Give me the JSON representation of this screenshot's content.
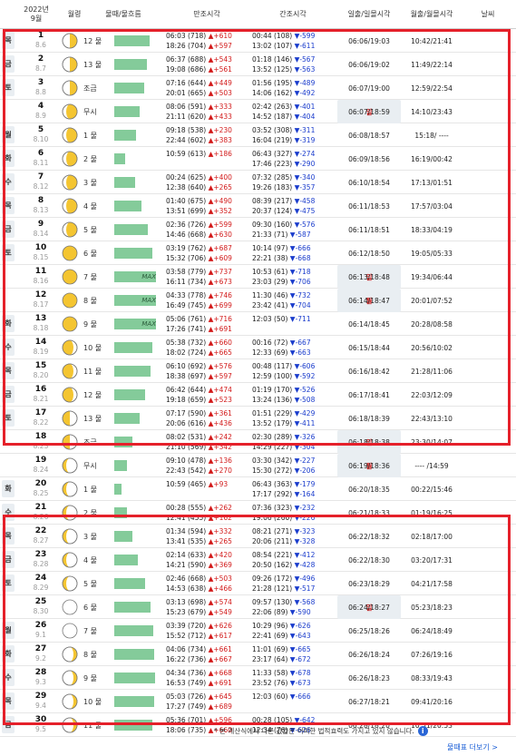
{
  "header": {
    "date": "2022년\n9월",
    "moon_phase": "월령",
    "tide_age": "물때/물흐름",
    "high_tide": "만조시각",
    "low_tide": "간조시각",
    "sunrise_set": "일출/일몰시각",
    "moonrise_set": "월출/월몰시각",
    "weather": "날씨"
  },
  "rows": [
    {
      "dow": "목",
      "sunday": false,
      "day": "1",
      "lunar": "8.6",
      "moon": "first-quarter",
      "tide": "12 물",
      "bar": 0.84,
      "max": "",
      "hw1": "06:03 (718)",
      "hw1d": "▲+610",
      "hw2": "18:26 (704)",
      "hw2d": "▲+597",
      "lw1": "00:44 (108)",
      "lw1d": "▼-599",
      "lw2": "13:02 (107)",
      "lw2d": "▼-611",
      "sun": "06:06/19:03",
      "moonrs": "10:42/21:41"
    },
    {
      "dow": "금",
      "sunday": false,
      "day": "2",
      "lunar": "8.7",
      "moon": "first-quarter",
      "tide": "13 물",
      "bar": 0.79,
      "max": "",
      "hw1": "06:37 (688)",
      "hw1d": "▲+543",
      "hw2": "19:08 (686)",
      "hw2d": "▲+561",
      "lw1": "01:18 (146)",
      "lw1d": "▼-567",
      "lw2": "13:52 (125)",
      "lw2d": "▼-563",
      "sun": "06:06/19:02",
      "moonrs": "11:49/22:14"
    },
    {
      "dow": "토",
      "sunday": false,
      "day": "3",
      "lunar": "8.8",
      "moon": "first-quarter",
      "tide": "조금",
      "bar": 0.71,
      "max": "",
      "hw1": "07:16 (644)",
      "hw1d": "▲+449",
      "hw2": "20:01 (665)",
      "hw2d": "▲+503",
      "lw1": "01:56 (195)",
      "lw1d": "▼-489",
      "lw2": "14:06 (162)",
      "lw2d": "▼-492",
      "sun": "06:07/19:00",
      "moonrs": "12:59/22:54"
    },
    {
      "dow": "일",
      "sunday": true,
      "day": "4",
      "lunar": "8.9",
      "moon": "waxing-gibbous",
      "tide": "무시",
      "bar": 0.6,
      "max": "",
      "hw1": "08:06 (591)",
      "hw1d": "▲+333",
      "hw2": "21:11 (620)",
      "hw2d": "▲+433",
      "lw1": "02:42 (263)",
      "lw1d": "▼-401",
      "lw2": "14:52 (187)",
      "lw2d": "▼-404",
      "sun": "06:07/18:59",
      "moonrs": "14:10/23:43"
    },
    {
      "dow": "월",
      "sunday": false,
      "day": "5",
      "lunar": "8.10",
      "moon": "waxing-gibbous",
      "tide": "1 물",
      "bar": 0.52,
      "max": "",
      "hw1": "09:18 (538)",
      "hw1d": "▲+230",
      "hw2": "22:44 (602)",
      "hw2d": "▲+383",
      "lw1": "03:52 (308)",
      "lw1d": "▼-311",
      "lw2": "16:04 (219)",
      "lw2d": "▼-319",
      "sun": "06:08/18:57",
      "moonrs": "15:18/ ----"
    },
    {
      "dow": "화",
      "sunday": false,
      "day": "6",
      "lunar": "8.11",
      "moon": "waxing-gibbous",
      "tide": "2 물",
      "bar": 0.25,
      "max": "",
      "hw1": "10:59 (613)",
      "hw1d": "▲+186",
      "hw2": "",
      "hw2d": "",
      "lw1": "06:43 (327)",
      "lw1d": "▼-274",
      "lw2": "17:46 (223)",
      "lw2d": "▼-290",
      "sun": "06:09/18:56",
      "moonrs": "16:19/00:42"
    },
    {
      "dow": "수",
      "sunday": false,
      "day": "7",
      "lunar": "8.12",
      "moon": "waxing-gibbous",
      "tide": "3 물",
      "bar": 0.5,
      "max": "",
      "hw1": "00:24 (625)",
      "hw1d": "▲+400",
      "hw2": "12:38 (640)",
      "hw2d": "▲+265",
      "lw1": "07:32 (285)",
      "lw1d": "▼-340",
      "lw2": "19:26 (183)",
      "lw2d": "▼-357",
      "sun": "06:10/18:54",
      "moonrs": "17:13/01:51"
    },
    {
      "dow": "목",
      "sunday": false,
      "day": "8",
      "lunar": "8.13",
      "moon": "waxing-gibbous",
      "tide": "4 물",
      "bar": 0.65,
      "max": "",
      "hw1": "01:40 (675)",
      "hw1d": "▲+490",
      "hw2": "13:51 (699)",
      "hw2d": "▲+352",
      "lw1": "08:39 (217)",
      "lw1d": "▼-458",
      "lw2": "20:37 (124)",
      "lw2d": "▼-475",
      "sun": "06:11/18:53",
      "moonrs": "17:57/03:04"
    },
    {
      "dow": "금",
      "sunday": false,
      "day": "9",
      "lunar": "8.14",
      "moon": "waxing-gibbous",
      "tide": "5 물",
      "bar": 0.81,
      "max": "",
      "hw1": "02:36 (726)",
      "hw1d": "▲+599",
      "hw2": "14:46 (668)",
      "hw2d": "▲+630",
      "lw1": "09:30 (160)",
      "lw1d": "▼-576",
      "lw2": "21:33 (71)",
      "lw2d": "▼-587",
      "sun": "06:11/18:51",
      "moonrs": "18:33/04:19"
    },
    {
      "dow": "토",
      "sunday": false,
      "day": "10",
      "lunar": "8.15",
      "moon": "full",
      "tide": "6 물",
      "bar": 0.92,
      "max": "",
      "hw1": "03:19 (762)",
      "hw1d": "▲+687",
      "hw2": "15:32 (706)",
      "hw2d": "▲+609",
      "lw1": "10:14 (97)",
      "lw1d": "▼-666",
      "lw2": "22:21 (38)",
      "lw2d": "▼-668",
      "sun": "06:12/18:50",
      "moonrs": "19:05/05:33"
    },
    {
      "dow": "일",
      "sunday": true,
      "day": "11",
      "lunar": "8.16",
      "moon": "full",
      "tide": "7 물",
      "bar": 1.0,
      "max": "MAX",
      "hw1": "03:58 (779)",
      "hw1d": "▲+737",
      "hw2": "16:11 (734)",
      "hw2d": "▲+673",
      "lw1": "10:53 (61)",
      "lw1d": "▼-718",
      "lw2": "23:03 (29)",
      "lw2d": "▼-706",
      "sun": "06:13/18:48",
      "moonrs": "19:34/06:44"
    },
    {
      "dow": "월",
      "sunday": true,
      "day": "12",
      "lunar": "8.17",
      "moon": "full",
      "tide": "8 물",
      "bar": 1.0,
      "max": "MAX",
      "hw1": "04:33 (778)",
      "hw1d": "▲+746",
      "hw2": "16:49 (745)",
      "hw2d": "▲+699",
      "lw1": "11:30 (46)",
      "lw1d": "▼-732",
      "lw2": "23:42 (41)",
      "lw2d": "▼-704",
      "sun": "06:14/18:47",
      "moonrs": "20:01/07:52"
    },
    {
      "dow": "화",
      "sunday": false,
      "day": "13",
      "lunar": "8.18",
      "moon": "full",
      "tide": "9 물",
      "bar": 1.0,
      "max": "MAX",
      "hw1": "05:06 (761)",
      "hw1d": "▲+716",
      "hw2": "17:26 (741)",
      "hw2d": "▲+691",
      "lw1": "12:03 (50)",
      "lw1d": "▼-711",
      "lw2": "",
      "lw2d": "",
      "sun": "06:14/18:45",
      "moonrs": "20:28/08:58"
    },
    {
      "dow": "수",
      "sunday": false,
      "day": "14",
      "lunar": "8.19",
      "moon": "waning-gibbous",
      "tide": "10 물",
      "bar": 0.92,
      "max": "",
      "hw1": "05:38 (732)",
      "hw1d": "▲+660",
      "hw2": "18:02 (724)",
      "hw2d": "▲+665",
      "lw1": "00:16 (72)",
      "lw1d": "▼-667",
      "lw2": "12:33 (69)",
      "lw2d": "▼-663",
      "sun": "06:15/18:44",
      "moonrs": "20:56/10:02"
    },
    {
      "dow": "목",
      "sunday": false,
      "day": "15",
      "lunar": "8.20",
      "moon": "waning-gibbous",
      "tide": "11 물",
      "bar": 0.86,
      "max": "",
      "hw1": "06:10 (692)",
      "hw1d": "▲+576",
      "hw2": "18:38 (697)",
      "hw2d": "▲+597",
      "lw1": "00:48 (117)",
      "lw1d": "▼-606",
      "lw2": "12:59 (100)",
      "lw2d": "▼-592",
      "sun": "06:16/18:42",
      "moonrs": "21:28/11:06"
    },
    {
      "dow": "금",
      "sunday": false,
      "day": "16",
      "lunar": "8.21",
      "moon": "waning-gibbous",
      "tide": "12 물",
      "bar": 0.74,
      "max": "",
      "hw1": "06:42 (644)",
      "hw1d": "▲+474",
      "hw2": "19:18 (659)",
      "hw2d": "▲+523",
      "lw1": "01:19 (170)",
      "lw1d": "▼-526",
      "lw2": "13:24 (136)",
      "lw2d": "▼-508",
      "sun": "06:17/18:41",
      "moonrs": "22:03/12:09"
    },
    {
      "dow": "토",
      "sunday": false,
      "day": "17",
      "lunar": "8.22",
      "moon": "last-quarter",
      "tide": "13 물",
      "bar": 0.6,
      "max": "",
      "hw1": "07:17 (590)",
      "hw1d": "▲+361",
      "hw2": "20:06 (616)",
      "hw2d": "▲+436",
      "lw1": "01:51 (229)",
      "lw1d": "▼-429",
      "lw2": "13:52 (179)",
      "lw2d": "▼-411",
      "sun": "06:18/18:39",
      "moonrs": "22:43/13:10"
    },
    {
      "dow": "일",
      "sunday": true,
      "day": "18",
      "lunar": "8.23",
      "moon": "last-quarter",
      "tide": "조금",
      "bar": 0.43,
      "max": "",
      "hw1": "08:02 (531)",
      "hw1d": "▲+242",
      "hw2": "21:10 (569)",
      "hw2d": "▲+342",
      "lw1": "02:30 (289)",
      "lw1d": "▼-326",
      "lw2": "14:29 (227)",
      "lw2d": "▼-304",
      "sun": "06:18/18:38",
      "moonrs": "23:30/14:07"
    },
    {
      "dow": "월",
      "sunday": true,
      "day": "19",
      "lunar": "8.24",
      "moon": "waning-crescent",
      "tide": "무시",
      "bar": 0.3,
      "max": "",
      "hw1": "09:10 (478)",
      "hw1d": "▲+136",
      "hw2": "22:43 (542)",
      "hw2d": "▲+270",
      "lw1": "03:30 (342)",
      "lw1d": "▼-227",
      "lw2": "15:30 (272)",
      "lw2d": "▼-206",
      "sun": "06:19/18:36",
      "moonrs": "---- /14:59"
    },
    {
      "dow": "화",
      "sunday": false,
      "day": "20",
      "lunar": "8.25",
      "moon": "waning-crescent",
      "tide": "1 물",
      "bar": 0.17,
      "max": "",
      "hw1": "10:59 (465)",
      "hw1d": "▲+93",
      "hw2": "",
      "hw2d": "",
      "lw1": "06:43 (363)",
      "lw1d": "▼-179",
      "lw2": "17:17 (292)",
      "lw2d": "▼-164",
      "sun": "06:20/18:35",
      "moonrs": "00:22/15:46"
    },
    {
      "dow": "수",
      "sunday": false,
      "day": "21",
      "lunar": "8.26",
      "moon": "waning-crescent",
      "tide": "2 물",
      "bar": 0.3,
      "max": "",
      "hw1": "00:28 (555)",
      "hw1d": "▲+262",
      "hw2": "12:41 (455)",
      "hw2d": "▲+162",
      "lw1": "07:36 (323)",
      "lw1d": "▼-232",
      "lw2": "19:06 (260)",
      "lw2d": "▼-226",
      "sun": "06:21/18:33",
      "moonrs": "01:19/16:25"
    },
    {
      "dow": "목",
      "sunday": false,
      "day": "22",
      "lunar": "8.27",
      "moon": "waning-crescent",
      "tide": "3 물",
      "bar": 0.43,
      "max": "",
      "hw1": "01:34 (594)",
      "hw1d": "▲+332",
      "hw2": "13:41 (535)",
      "hw2d": "▲+265",
      "lw1": "08:21 (271)",
      "lw1d": "▼-323",
      "lw2": "20:06 (211)",
      "lw2d": "▼-328",
      "sun": "06:22/18:32",
      "moonrs": "02:18/17:00"
    },
    {
      "dow": "금",
      "sunday": false,
      "day": "23",
      "lunar": "8.28",
      "moon": "waning-crescent",
      "tide": "4 물",
      "bar": 0.57,
      "max": "",
      "hw1": "02:14 (633)",
      "hw1d": "▲+420",
      "hw2": "14:21 (590)",
      "hw2d": "▲+369",
      "lw1": "08:54 (221)",
      "lw1d": "▼-412",
      "lw2": "20:50 (162)",
      "lw2d": "▼-428",
      "sun": "06:22/18:30",
      "moonrs": "03:20/17:31"
    },
    {
      "dow": "토",
      "sunday": false,
      "day": "24",
      "lunar": "8.29",
      "moon": "waning-crescent",
      "tide": "5 물",
      "bar": 0.73,
      "max": "",
      "hw1": "02:46 (668)",
      "hw1d": "▲+503",
      "hw2": "14:53 (638)",
      "hw2d": "▲+466",
      "lw1": "09:26 (172)",
      "lw1d": "▼-496",
      "lw2": "21:28 (121)",
      "lw2d": "▼-517",
      "sun": "06:23/18:29",
      "moonrs": "04:21/17:58"
    },
    {
      "dow": "일",
      "sunday": true,
      "day": "25",
      "lunar": "8.30",
      "moon": "new",
      "tide": "6 물",
      "bar": 0.86,
      "max": "",
      "hw1": "03:13 (698)",
      "hw1d": "▲+574",
      "hw2": "15:23 (679)",
      "hw2d": "▲+549",
      "lw1": "09:57 (130)",
      "lw1d": "▼-568",
      "lw2": "22:06 (89)",
      "lw2d": "▼-590",
      "sun": "06:24/18:27",
      "moonrs": "05:23/18:23"
    },
    {
      "dow": "월",
      "sunday": false,
      "day": "26",
      "lunar": "9.1",
      "moon": "new",
      "tide": "7 물",
      "bar": 0.94,
      "max": "",
      "hw1": "03:39 (720)",
      "hw1d": "▲+626",
      "hw2": "15:52 (712)",
      "hw2d": "▲+617",
      "lw1": "10:29 (96)",
      "lw1d": "▼-626",
      "lw2": "22:41 (69)",
      "lw2d": "▼-643",
      "sun": "06:25/18:26",
      "moonrs": "06:24/18:49"
    },
    {
      "dow": "화",
      "sunday": false,
      "day": "27",
      "lunar": "9.2",
      "moon": "waxing-crescent",
      "tide": "8 물",
      "bar": 0.96,
      "max": "",
      "hw1": "04:06 (734)",
      "hw1d": "▲+661",
      "hw2": "16:22 (736)",
      "hw2d": "▲+667",
      "lw1": "11:01 (69)",
      "lw1d": "▼-665",
      "lw2": "23:17 (64)",
      "lw2d": "▼-672",
      "sun": "06:26/18:24",
      "moonrs": "07:26/19:16"
    },
    {
      "dow": "수",
      "sunday": false,
      "day": "28",
      "lunar": "9.3",
      "moon": "waxing-crescent",
      "tide": "9 물",
      "bar": 0.97,
      "max": "",
      "hw1": "04:34 (736)",
      "hw1d": "▲+668",
      "hw2": "16:53 (749)",
      "hw2d": "▲+691",
      "lw1": "11:33 (58)",
      "lw1d": "▼-678",
      "lw2": "23:52 (76)",
      "lw2d": "▼-673",
      "sun": "06:26/18:23",
      "moonrs": "08:33/19:43"
    },
    {
      "dow": "목",
      "sunday": false,
      "day": "29",
      "lunar": "9.4",
      "moon": "waxing-crescent",
      "tide": "10 물",
      "bar": 0.96,
      "max": "",
      "hw1": "05:03 (726)",
      "hw1d": "▲+645",
      "hw2": "17:27 (749)",
      "hw2d": "▲+689",
      "lw1": "12:03 (60)",
      "lw1d": "▼-666",
      "lw2": "",
      "lw2d": "",
      "sun": "06:27/18:21",
      "moonrs": "09:41/20:16"
    },
    {
      "dow": "금",
      "sunday": false,
      "day": "30",
      "lunar": "9.5",
      "moon": "waxing-crescent",
      "tide": "11 물",
      "bar": 0.92,
      "max": "",
      "hw1": "05:36 (701)",
      "hw1d": "▲+596",
      "hw2": "18:06 (735)",
      "hw2d": "▲+660",
      "lw1": "00:28 (105)",
      "lw1d": "▼-642",
      "lw2": "12:34 (76)",
      "lw2d": "▼-626",
      "sun": "06:28/18:20",
      "moonrs": "10:51/20:53"
    }
  ],
  "footnote": "* 본 계산식에서 다른 값들은 어떠한 법적효력도 가지고 있지 않습니다.",
  "footnote_icon": "info-icon",
  "more_link": "물때표 더보기 >",
  "colors": {
    "tide_bar": "#84cb9a",
    "up": "#d21a1a",
    "down": "#1a3ccc",
    "highlight": "#e5202a",
    "dow_bg": "#e9eef2"
  }
}
